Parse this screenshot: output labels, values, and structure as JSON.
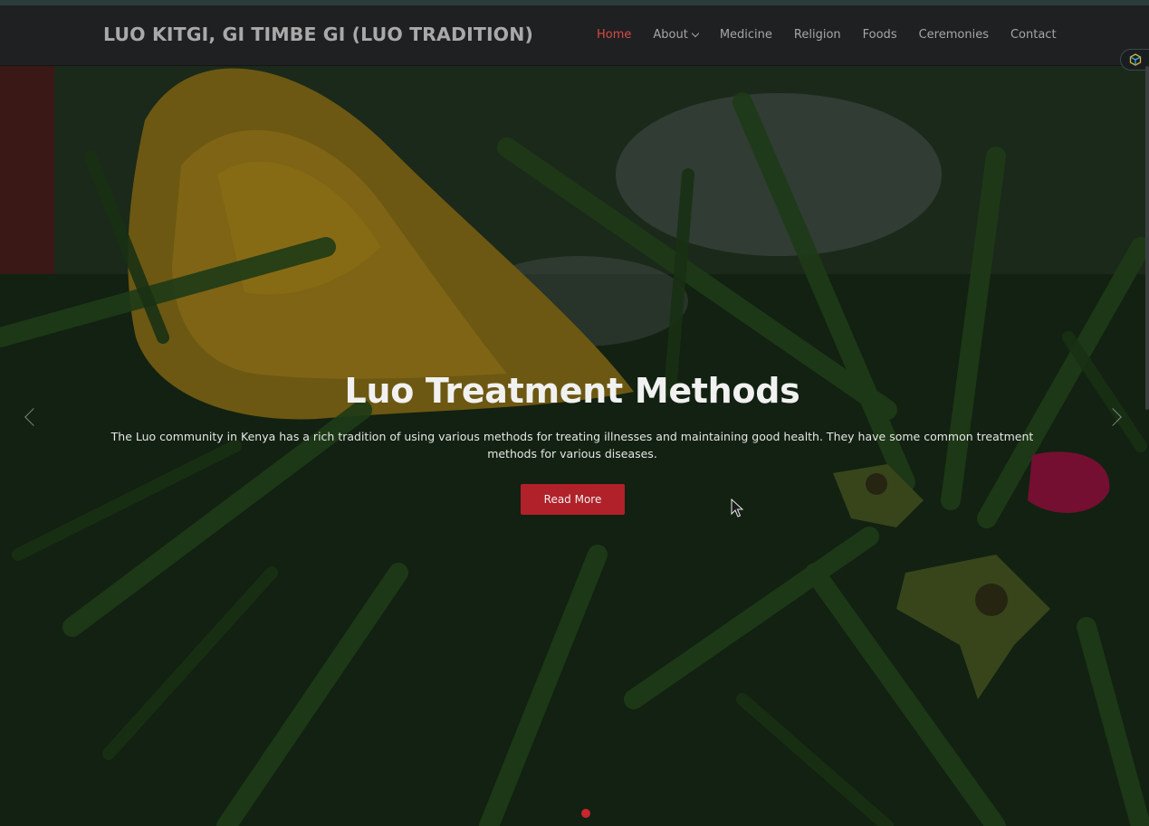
{
  "header": {
    "brand": "LUO KITGI, GI TIMBE GI (LUO TRADITION)",
    "nav": [
      {
        "label": "Home",
        "active": true
      },
      {
        "label": "About",
        "has_dropdown": true
      },
      {
        "label": "Medicine"
      },
      {
        "label": "Religion"
      },
      {
        "label": "Foods"
      },
      {
        "label": "Ceremonies"
      },
      {
        "label": "Contact"
      }
    ]
  },
  "hero": {
    "title": "Luo Treatment Methods",
    "description": "The Luo community in Kenya has a rich tradition of using various methods for treating illnesses and maintaining good health. They have some common treatment methods for various diseases.",
    "button_label": "Read More",
    "slide_count": 1,
    "active_slide": 1
  },
  "colors": {
    "accent": "#d64b44",
    "button": "#b1212a",
    "navbar_bg": "#1f2022"
  },
  "icons": [
    "chevron-down-icon",
    "carousel-prev-icon",
    "carousel-next-icon",
    "extension-icon",
    "mouse-cursor-icon"
  ]
}
